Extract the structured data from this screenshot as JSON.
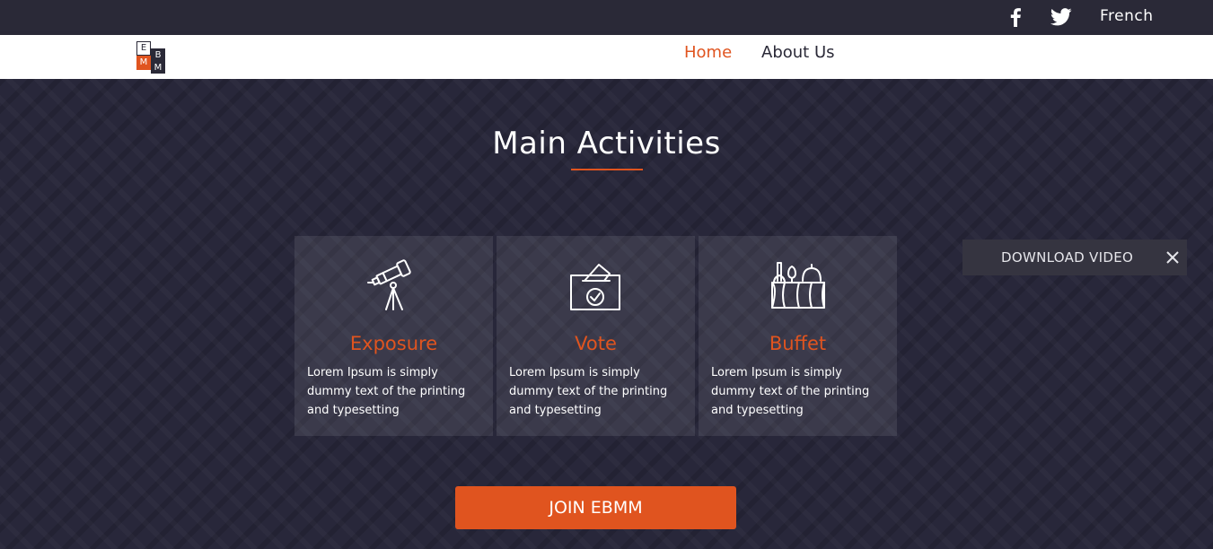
{
  "topbar": {
    "facebook_icon": "facebook-icon",
    "twitter_icon": "twitter-icon",
    "language": "French"
  },
  "logo": {
    "letters": [
      "E",
      "B",
      "M",
      "M"
    ]
  },
  "nav": {
    "home": "Home",
    "about": "About Us",
    "active_color": "#e0541f"
  },
  "main": {
    "title": "Main Activities",
    "cards": [
      {
        "title": "Exposure",
        "text": "Lorem Ipsum is simply dummy text of the printing and typesetting",
        "icon": "telescope-icon"
      },
      {
        "title": "Vote",
        "text": "Lorem Ipsum is simply dummy text of the printing and typesetting",
        "icon": "ballot-box-icon"
      },
      {
        "title": "Buffet",
        "text": "Lorem Ipsum is simply dummy text of the printing and typesetting",
        "icon": "buffet-icon"
      }
    ],
    "join_button": "JOIN EBMM"
  },
  "download_popup": {
    "label": "DOWNLOAD VIDEO",
    "close_icon": "close-icon"
  },
  "colors": {
    "accent": "#e0541f",
    "background": "#2a2937"
  }
}
